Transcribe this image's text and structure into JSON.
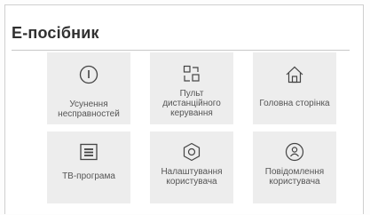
{
  "page": {
    "title": "Е-посібник"
  },
  "tiles": [
    {
      "label": "Усунення несправностей",
      "icon": "info-circle-icon"
    },
    {
      "label": "Пульт дистанційного керування",
      "icon": "remote-buttons-icon"
    },
    {
      "label": "Головна сторінка",
      "icon": "home-icon"
    },
    {
      "label": "ТВ-програма",
      "icon": "tv-guide-list-icon"
    },
    {
      "label": "Налаштування користувача",
      "icon": "settings-hexagon-icon"
    },
    {
      "label": "Повідомлення користувача",
      "icon": "user-circle-icon"
    }
  ]
}
